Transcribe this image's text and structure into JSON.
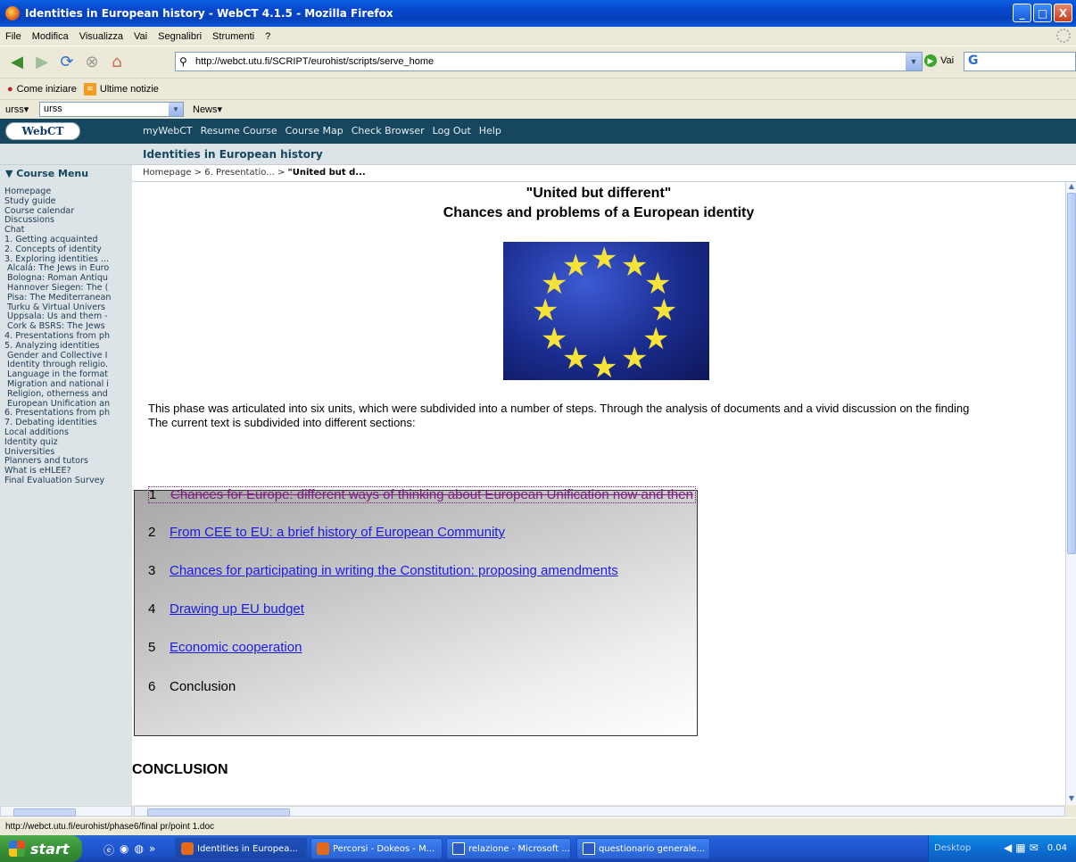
{
  "window": {
    "title": "Identities in European history - WebCT 4.1.5 - Mozilla Firefox",
    "controls": [
      "_",
      "□",
      "X"
    ]
  },
  "menubar": [
    "File",
    "Modifica",
    "Visualizza",
    "Vai",
    "Segnalibri",
    "Strumenti",
    "?"
  ],
  "navbar": {
    "url": "http://webct.utu.fi/SCRIPT/eurohist/scripts/serve_home",
    "go_label": "Vai"
  },
  "bookmarks": [
    "Come iniziare",
    "Ultime notizie"
  ],
  "toolbar2": {
    "left_label": "urss▾",
    "select_value": "urss",
    "news_label": "News▾"
  },
  "webct": {
    "logo": "WebCT",
    "nav": [
      "myWebCT",
      "Resume Course",
      "Course Map",
      "Check Browser",
      "Log Out",
      "Help"
    ],
    "course_title": "Identities in European history",
    "course_menu_label": "▼ Course Menu",
    "breadcrumb_prefix": "Homepage > 6. Presentatio... > ",
    "breadcrumb_current": "\"United but d..."
  },
  "sidebar": [
    {
      "label": "Homepage",
      "indent": false
    },
    {
      "label": "Study guide",
      "indent": false
    },
    {
      "label": "Course calendar",
      "indent": false
    },
    {
      "label": "Discussions",
      "indent": false
    },
    {
      "label": "Chat",
      "indent": false
    },
    {
      "label": "1. Getting acquainted",
      "indent": false
    },
    {
      "label": "2. Concepts of identity",
      "indent": false
    },
    {
      "label": "3. Exploring identities ...",
      "indent": false
    },
    {
      "label": "Alcalá: The Jews in Euro",
      "indent": true
    },
    {
      "label": "Bologna: Roman Antiqu",
      "indent": true
    },
    {
      "label": "Hannover Siegen: The (",
      "indent": true
    },
    {
      "label": "Pisa: The Mediterranean",
      "indent": true
    },
    {
      "label": "Turku & Virtual Univers",
      "indent": true
    },
    {
      "label": "Uppsala: Us and them -",
      "indent": true
    },
    {
      "label": "Cork & BSRS: The Jews",
      "indent": true
    },
    {
      "label": "4. Presentations from ph",
      "indent": false
    },
    {
      "label": "5. Analyzing identities",
      "indent": false
    },
    {
      "label": "Gender and Collective I",
      "indent": true
    },
    {
      "label": "Identity through religio.",
      "indent": true
    },
    {
      "label": "Language in the format",
      "indent": true
    },
    {
      "label": "Migration and national i",
      "indent": true
    },
    {
      "label": "Religion, otherness and",
      "indent": true
    },
    {
      "label": "European Unification an",
      "indent": true
    },
    {
      "label": "6. Presentations from ph",
      "indent": false
    },
    {
      "label": "7. Debating identities",
      "indent": false
    },
    {
      "label": "Local additions",
      "indent": false
    },
    {
      "label": "Identity quiz",
      "indent": false
    },
    {
      "label": "Universities",
      "indent": false
    },
    {
      "label": "Planners and tutors",
      "indent": false
    },
    {
      "label": "What is eHLEE?",
      "indent": false
    },
    {
      "label": "Final Evaluation Survey",
      "indent": false
    }
  ],
  "content": {
    "title_line1": "\"United but different\"",
    "title_line2": "Chances and problems of a European identity",
    "intro_line1": "This phase was articulated into six units, which were subdivided into a number of steps. Through the analysis of documents and a vivid discussion on the finding",
    "intro_line2": "The current text is subdivided into different sections:",
    "toc": [
      {
        "num": "1",
        "label": "Chances for Europe: different ways of thinking about European Unification now and then",
        "link": true,
        "visited": true
      },
      {
        "num": "2",
        "label": "From CEE to EU: a brief history of European Community",
        "link": true,
        "visited": false
      },
      {
        "num": "3",
        "label": "Chances for participating in writing the Constitution: proposing amendments",
        "link": true,
        "visited": false
      },
      {
        "num": "4",
        "label": "Drawing up EU budget",
        "link": true,
        "visited": false
      },
      {
        "num": "5",
        "label": "Economic cooperation",
        "link": true,
        "visited": false
      },
      {
        "num": "6",
        "label": "Conclusion",
        "link": false,
        "visited": false
      }
    ],
    "conclusion_heading": "CONCLUSION"
  },
  "statusbar": "http://webct.utu.fi/eurohist/phase6/final pr/point 1.doc",
  "taskbar": {
    "start": "start",
    "tasks": [
      {
        "label": "Identities in Europea...",
        "icon": "firefox",
        "active": true
      },
      {
        "label": "Percorsi - Dokeos - M...",
        "icon": "firefox",
        "active": false
      },
      {
        "label": "relazione - Microsoft ...",
        "icon": "word",
        "active": false
      },
      {
        "label": "questionario generale...",
        "icon": "word",
        "active": false
      }
    ],
    "desktop_label": "Desktop",
    "clock": "0.04"
  }
}
